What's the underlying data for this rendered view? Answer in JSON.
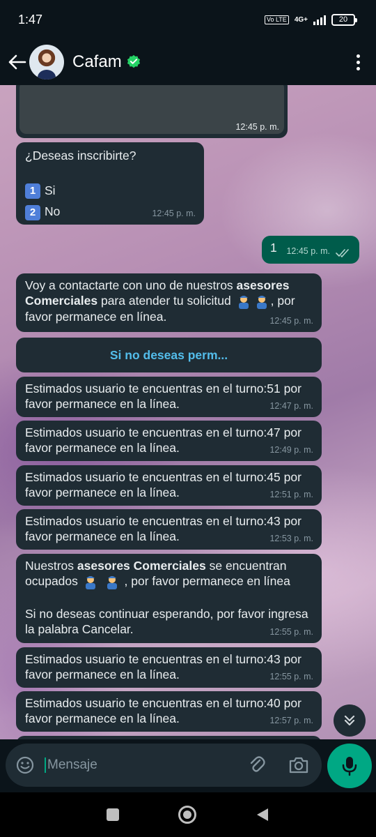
{
  "status": {
    "time": "1:47",
    "network": "4G+",
    "volte": "Vo LTE",
    "battery": "20"
  },
  "header": {
    "contact_name": "Cafam"
  },
  "messages": {
    "m0_time": "12:45 p. m.",
    "m1_question": "¿Deseas inscribirte?",
    "m1_opt1_num": "1",
    "m1_opt1": "Si",
    "m1_opt2_num": "2",
    "m1_opt2": "No",
    "m1_time": "12:45 p. m.",
    "m2_text": "1",
    "m2_time": "12:45 p. m.",
    "m3_part1": "Voy a contactarte con uno de nuestros ",
    "m3_bold": "asesores Comerciales",
    "m3_part2": " para atender tu solicitud ",
    "m3_part3": ", por favor permanece en línea.",
    "m3_time": "12:45 p. m.",
    "link_button": "Si no deseas perm...",
    "m4_text": "Estimados usuario te encuentras en el turno:51 por favor permanece en la línea.",
    "m4_time": "12:47 p. m.",
    "m5_text": "Estimados usuario te encuentras en el turno:47 por favor permanece en la línea.",
    "m5_time": "12:49 p. m.",
    "m6_text": "Estimados usuario te encuentras en el turno:45 por favor permanece en la línea.",
    "m6_time": "12:51 p. m.",
    "m7_text": "Estimados usuario te encuentras en el turno:43 por favor permanece en la línea.",
    "m7_time": "12:53 p. m.",
    "m8_part1": "Nuestros ",
    "m8_bold": "asesores Comerciales",
    "m8_part2": " se encuentran ocupados ",
    "m8_part3": " , por favor permanece en línea",
    "m8_part4": "Si no deseas continuar esperando, por favor ingresa la palabra Cancelar.",
    "m8_time": "12:55 p. m.",
    "m9_text": "Estimados usuario te encuentras en el turno:43 por favor permanece en la línea.",
    "m9_time": "12:55 p. m.",
    "m10_text": "Estimados usuario te encuentras en el turno:40 por favor permanece en la línea.",
    "m10_time": "12:57 p. m."
  },
  "input": {
    "placeholder": "Mensaje"
  },
  "colors": {
    "accent": "#00a884",
    "bubble_in": "#1f2c34",
    "bubble_out": "#005c4b",
    "link": "#53bdeb"
  },
  "icons": [
    "back-arrow-icon",
    "verified-badge-icon",
    "more-options-icon",
    "double-check-icon",
    "emoji-icon",
    "attach-icon",
    "camera-icon",
    "mic-icon",
    "scroll-down-icon",
    "nav-recents-icon",
    "nav-home-icon",
    "nav-back-icon"
  ]
}
